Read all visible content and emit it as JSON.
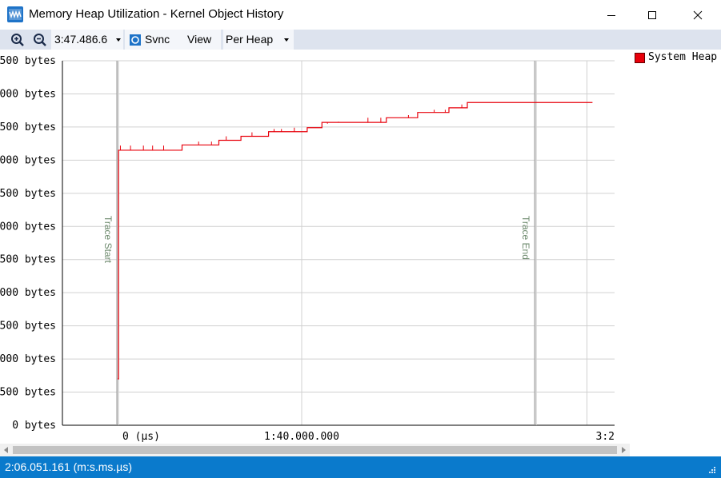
{
  "window": {
    "title": "Memory Heap Utilization - Kernel Object History",
    "icon": "waveform-app-icon",
    "controls": [
      "minimize-icon",
      "maximize-icon",
      "close-icon"
    ]
  },
  "toolbar": {
    "zoom_in_icon": "zoom-in-icon",
    "zoom_out_icon": "zoom-out-icon",
    "time_value": "3:47.486.6",
    "sync_label": "Svnc",
    "view_label": "View",
    "heap_mode": "Per Heap"
  },
  "legend": {
    "items": [
      {
        "label": "System Heap",
        "color": "#e8000b"
      }
    ]
  },
  "status": {
    "text": "2:06.051.161 (m:s.ms.µs)"
  },
  "colors": {
    "series": "#e8000b",
    "status_bar": "#0a7acc",
    "toolbar": "#dde3ee",
    "marker_line": "#9a9a9a",
    "marker_text": "#6d8a6d"
  },
  "chart_data": {
    "type": "line",
    "y_tick_labels": [
      "0 bytes",
      "500 bytes",
      "000 bytes",
      "500 bytes",
      "000 bytes",
      "500 bytes",
      "000 bytes",
      "500 bytes",
      "000 bytes",
      "500 bytes",
      "000 bytes",
      "500 bytes"
    ],
    "x_tick_labels": [
      "0 (µs)",
      "1:40.000.000",
      "3:2"
    ],
    "ylim": [
      0,
      5500
    ],
    "xlim": [
      -30,
      270
    ],
    "x_units": "seconds",
    "markers": [
      {
        "label": "Trace Start",
        "x": 0
      },
      {
        "label": "Trace End",
        "x": 227
      }
    ],
    "series": [
      {
        "name": "System Heap",
        "steps": [
          [
            0,
            700
          ],
          [
            0.5,
            4150
          ],
          [
            35,
            4150
          ],
          [
            35,
            4230
          ],
          [
            55,
            4230
          ],
          [
            55,
            4300
          ],
          [
            67,
            4300
          ],
          [
            67,
            4360
          ],
          [
            82,
            4360
          ],
          [
            82,
            4430
          ],
          [
            103,
            4430
          ],
          [
            103,
            4490
          ],
          [
            111,
            4490
          ],
          [
            111,
            4570
          ],
          [
            129,
            4570
          ],
          [
            129,
            4570
          ],
          [
            146,
            4570
          ],
          [
            146,
            4640
          ],
          [
            163,
            4640
          ],
          [
            163,
            4720
          ],
          [
            180,
            4720
          ],
          [
            180,
            4790
          ],
          [
            190,
            4790
          ],
          [
            190,
            4870
          ],
          [
            230,
            4870
          ],
          [
            258,
            4870
          ]
        ],
        "spikes": [
          [
            1.5,
            4220
          ],
          [
            7,
            4220
          ],
          [
            14,
            4220
          ],
          [
            19,
            4220
          ],
          [
            25,
            4220
          ],
          [
            44,
            4280
          ],
          [
            51,
            4280
          ],
          [
            59,
            4360
          ],
          [
            73,
            4420
          ],
          [
            85,
            4470
          ],
          [
            89,
            4470
          ],
          [
            96,
            4490
          ],
          [
            103,
            4490
          ],
          [
            108,
            4490
          ],
          [
            114,
            4550
          ],
          [
            120,
            4580
          ],
          [
            136,
            4640
          ],
          [
            143,
            4640
          ],
          [
            149,
            4640
          ],
          [
            153,
            4640
          ],
          [
            158,
            4680
          ],
          [
            172,
            4760
          ],
          [
            178,
            4760
          ],
          [
            187,
            4840
          ]
        ]
      }
    ]
  }
}
